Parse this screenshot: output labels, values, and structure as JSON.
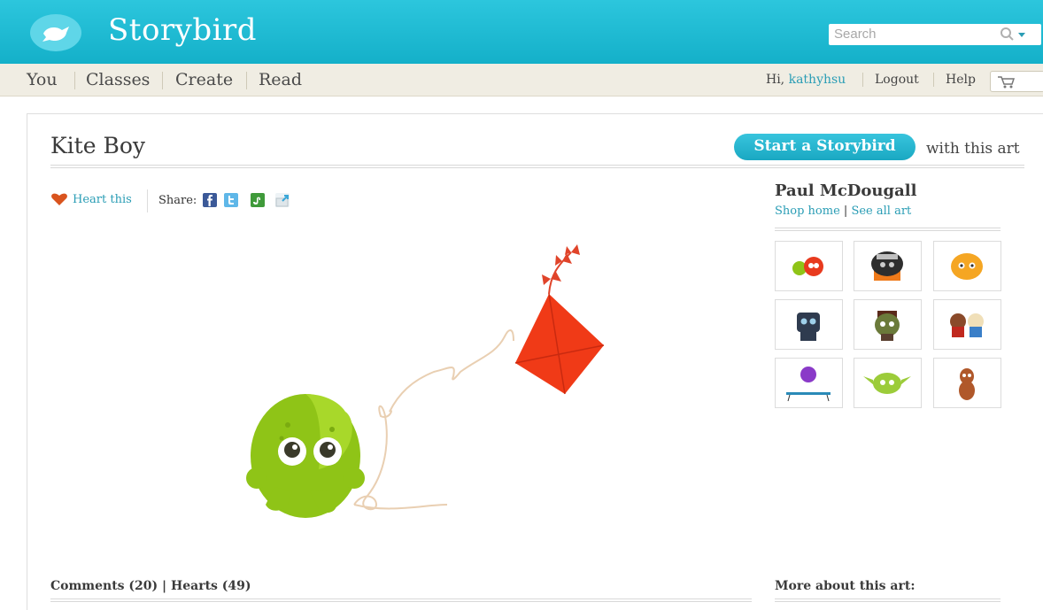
{
  "header": {
    "logo_text": "Storybird",
    "search_placeholder": "Search"
  },
  "nav": {
    "items": [
      "You",
      "Classes",
      "Create",
      "Read"
    ],
    "greeting": "Hi,",
    "username": "kathyhsu",
    "logout": "Logout",
    "help": "Help"
  },
  "art": {
    "title": "Kite Boy",
    "start_button": "Start a Storybird",
    "with_art": "with this art",
    "heart_label": "Heart this",
    "share_label": "Share:"
  },
  "artist": {
    "name": "Paul McDougall",
    "shop_home": "Shop home",
    "see_all": "See all art",
    "separator": "|"
  },
  "footer": {
    "comments": "Comments (20) | Hearts (49)",
    "more": "More about this art:"
  },
  "colors": {
    "brand": "#14b0c9",
    "link": "#2a9db5",
    "heart": "#d9541e",
    "kite": "#f03a17",
    "monster": "#9ccc1a"
  },
  "icons": [
    "bird-logo-icon",
    "search-icon",
    "cart-icon",
    "heart-icon",
    "facebook-icon",
    "twitter-icon",
    "stumbleupon-icon",
    "email-share-icon"
  ]
}
